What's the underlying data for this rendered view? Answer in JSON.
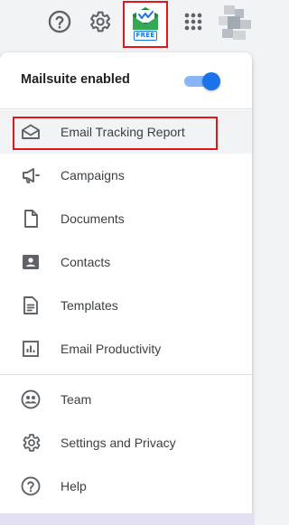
{
  "topbar": {
    "help_icon": "help-circle-icon",
    "settings_icon": "gear-icon",
    "extension": {
      "logo_icon": "mailsuite-envelope-icon",
      "badge": "FREE",
      "accent": "#e8131b"
    },
    "apps_icon": "apps-grid-icon",
    "avatar": "pixelated-avatar"
  },
  "panel": {
    "enabled_label": "Mailsuite enabled",
    "toggle_on": true,
    "toggle_color": "#1a73e8",
    "items": [
      {
        "label": "Email Tracking Report",
        "icon": "envelope-open-icon",
        "active": true
      },
      {
        "label": "Campaigns",
        "icon": "megaphone-icon"
      },
      {
        "label": "Documents",
        "icon": "document-icon"
      },
      {
        "label": "Contacts",
        "icon": "contact-card-icon"
      },
      {
        "label": "Templates",
        "icon": "template-icon"
      },
      {
        "label": "Email Productivity",
        "icon": "bar-chart-icon"
      }
    ],
    "footer_items": [
      {
        "label": "Team",
        "icon": "team-icon"
      },
      {
        "label": "Settings and Privacy",
        "icon": "gear-icon"
      },
      {
        "label": "Help",
        "icon": "help-circle-icon"
      }
    ]
  }
}
